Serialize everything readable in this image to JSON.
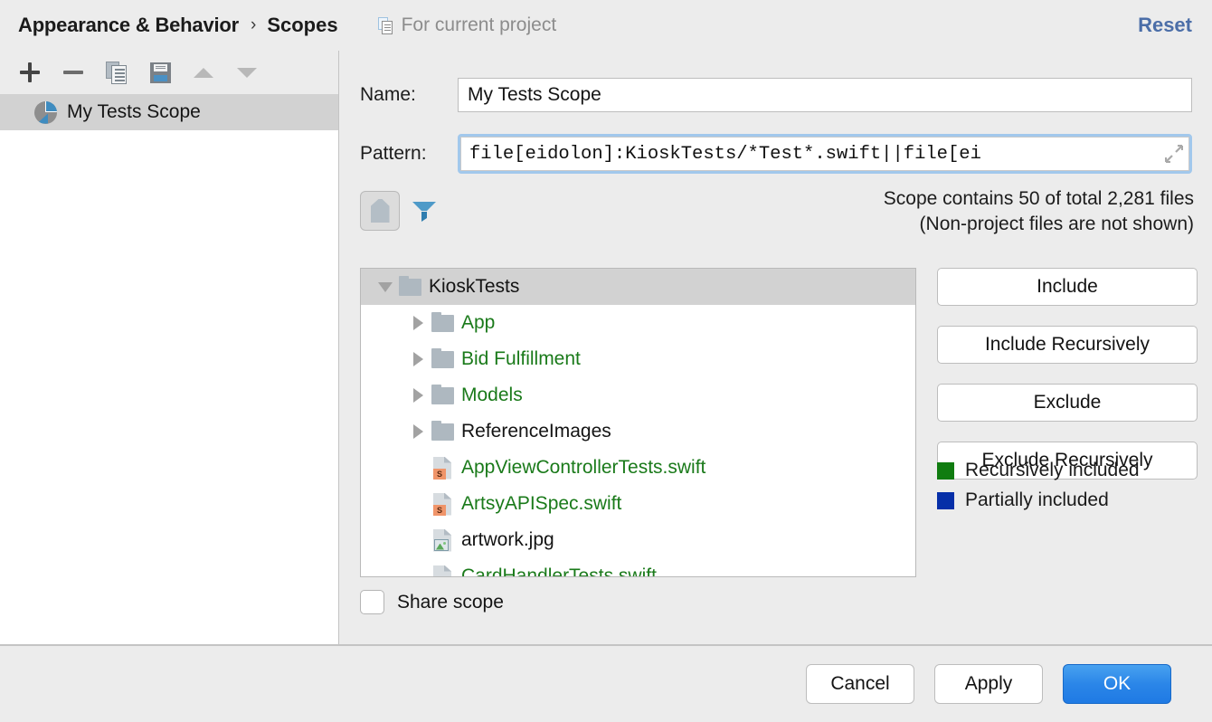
{
  "header": {
    "breadcrumb_root": "Appearance & Behavior",
    "breadcrumb_separator": "›",
    "breadcrumb_current": "Scopes",
    "project_note": "For current project",
    "project_note_icon": "copy-project-icon",
    "reset_label": "Reset",
    "reset_color": "#4b6ea8"
  },
  "sidebar": {
    "toolbar": [
      {
        "name": "add-scope-button",
        "icon": "plus-icon",
        "label": "+"
      },
      {
        "name": "remove-scope-button",
        "icon": "minus-icon",
        "label": "−"
      },
      {
        "name": "copy-scope-button",
        "icon": "copy-icon",
        "label": "Copy"
      },
      {
        "name": "save-scope-button",
        "icon": "save-icon",
        "label": "Save"
      },
      {
        "name": "move-up-button",
        "icon": "arrow-up-icon",
        "label": "Move Up"
      },
      {
        "name": "move-down-button",
        "icon": "arrow-down-icon",
        "label": "Move Down"
      }
    ],
    "scopes": [
      {
        "label": "My Tests Scope",
        "icon": "pie-chart-icon",
        "selected": true
      }
    ]
  },
  "form": {
    "name_label": "Name:",
    "name_value": "My Tests Scope",
    "name_placeholder": "",
    "pattern_label": "Pattern:",
    "pattern_value": "file[eidolon]:KioskTests/*Test*.swift||file[ei",
    "pattern_placeholder": "",
    "pattern_expand_icon": "expand-icon",
    "pattern_focused": true
  },
  "filter_bar": {
    "show_files_toggle": {
      "name": "show-files-toggle",
      "icon": "file-icon",
      "pressed": true
    },
    "filter_button": {
      "name": "filter-button",
      "icon": "funnel-icon",
      "color": "#3f8cc0"
    }
  },
  "stats": {
    "line1": "Scope contains 50 of total 2,281 files",
    "line2": "(Non-project files are not shown)",
    "included_count": 50,
    "total_count": "2,281"
  },
  "tree": {
    "rows": [
      {
        "label": "KioskTests",
        "type": "folder",
        "depth": 0,
        "expanded": true,
        "twisty": "down",
        "color": "black",
        "selected": true
      },
      {
        "label": "App",
        "type": "folder",
        "depth": 1,
        "expanded": false,
        "twisty": "right",
        "color": "green",
        "selected": false
      },
      {
        "label": "Bid Fulfillment",
        "type": "folder",
        "depth": 1,
        "expanded": false,
        "twisty": "right",
        "color": "green",
        "selected": false
      },
      {
        "label": "Models",
        "type": "folder",
        "depth": 1,
        "expanded": false,
        "twisty": "right",
        "color": "green",
        "selected": false
      },
      {
        "label": "ReferenceImages",
        "type": "folder",
        "depth": 1,
        "expanded": false,
        "twisty": "right",
        "color": "black",
        "selected": false
      },
      {
        "label": "AppViewControllerTests.swift",
        "type": "swift",
        "depth": 1,
        "expanded": false,
        "twisty": "none",
        "color": "green",
        "selected": false
      },
      {
        "label": "ArtsyAPISpec.swift",
        "type": "swift",
        "depth": 1,
        "expanded": false,
        "twisty": "none",
        "color": "green",
        "selected": false
      },
      {
        "label": "artwork.jpg",
        "type": "image",
        "depth": 1,
        "expanded": false,
        "twisty": "none",
        "color": "black",
        "selected": false
      },
      {
        "label": "CardHandlerTests.swift",
        "type": "swift",
        "depth": 1,
        "expanded": false,
        "twisty": "none",
        "color": "green",
        "selected": false
      }
    ],
    "swift_badge_text": "S"
  },
  "actions": {
    "buttons": [
      {
        "label": "Include",
        "name": "include-button"
      },
      {
        "label": "Include Recursively",
        "name": "include-recursively-button"
      },
      {
        "label": "Exclude",
        "name": "exclude-button"
      },
      {
        "label": "Exclude Recursively",
        "name": "exclude-recursively-button"
      }
    ]
  },
  "legend": [
    {
      "label": "Recursively included",
      "color": "#107c10"
    },
    {
      "label": "Partially included",
      "color": "#062fa8"
    }
  ],
  "share": {
    "label": "Share scope",
    "checked": false
  },
  "footer": {
    "cancel_label": "Cancel",
    "apply_label": "Apply",
    "ok_label": "OK",
    "ok_accent": "#2b86e8"
  }
}
